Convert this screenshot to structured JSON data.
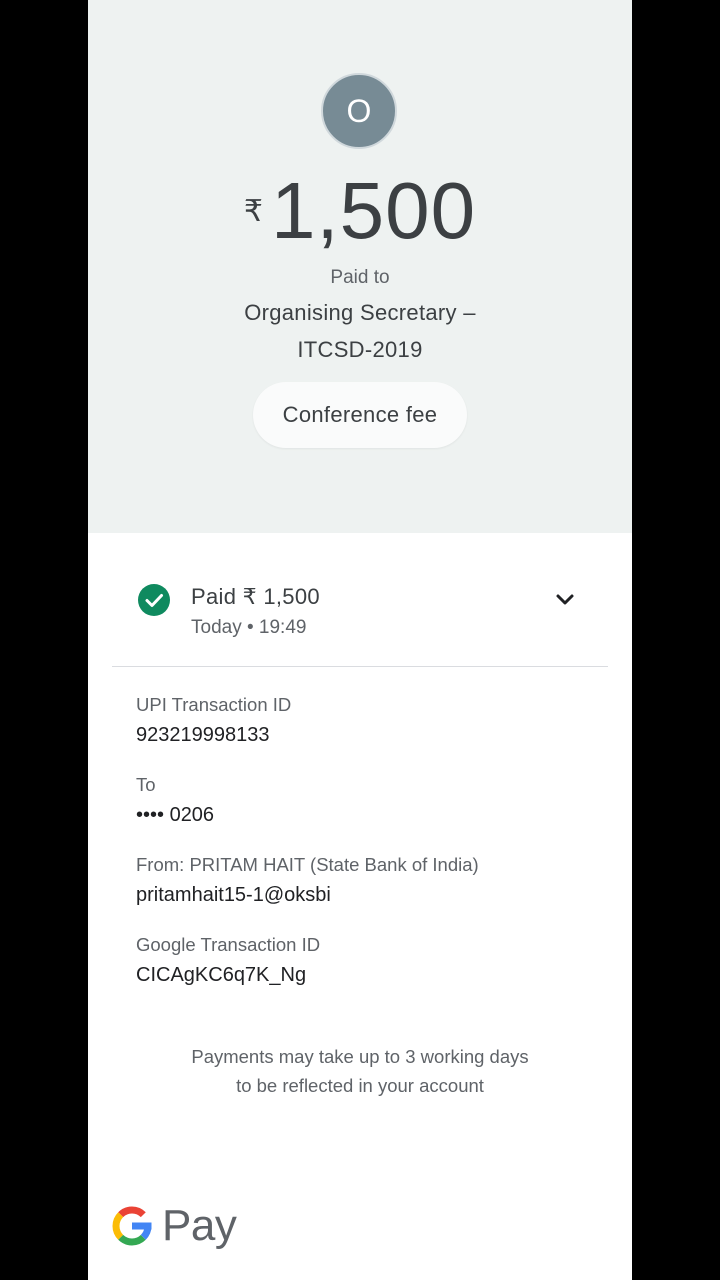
{
  "payee_avatar": {
    "initial": "O",
    "color": "#778b95"
  },
  "payment": {
    "currency_symbol": "₹",
    "amount": "1,500",
    "paid_to_label": "Paid to",
    "payee_line1": "Organising Secretary –",
    "payee_line2": "ITCSD-2019",
    "note": "Conference fee"
  },
  "status": {
    "text": "Paid ₹ 1,500",
    "time": "Today • 19:49",
    "icon": "check-circle-icon",
    "color": "#188038"
  },
  "details": [
    {
      "label": "UPI Transaction ID",
      "value": "923219998133"
    },
    {
      "label": "To",
      "value": "•••• 0206"
    },
    {
      "label": "From: PRITAM  HAIT (State Bank of India)",
      "value": "pritamhait15-1@oksbi"
    },
    {
      "label": "Google Transaction ID",
      "value": "CICAgKC6q7K_Ng"
    }
  ],
  "footer": {
    "line1": "Payments may take up to 3 working days",
    "line2": "to be reflected in your account"
  },
  "brand": {
    "word": "Pay",
    "colors": {
      "blue": "#4285f4",
      "red": "#ea4335",
      "yellow": "#fbbc05",
      "green": "#34a853"
    }
  }
}
